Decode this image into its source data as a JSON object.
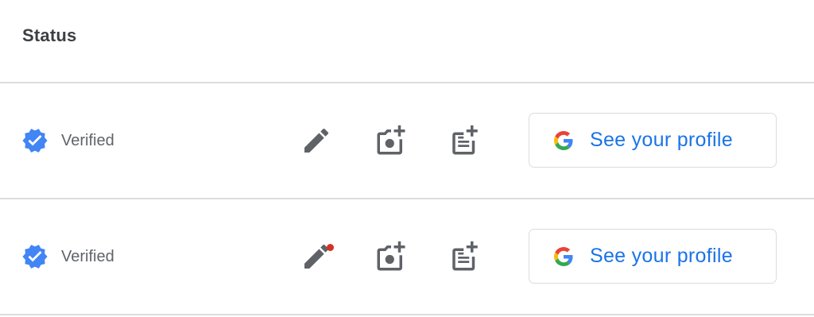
{
  "header": {
    "title": "Status"
  },
  "rows": [
    {
      "status": "Verified",
      "status_icon": "verified-badge-icon",
      "edit_has_notification": false,
      "actions": [
        "edit-pencil-icon",
        "add-photo-icon",
        "add-post-icon"
      ],
      "button_label": "See your profile",
      "button_icon": "google-g-icon"
    },
    {
      "status": "Verified",
      "status_icon": "verified-badge-icon",
      "edit_has_notification": true,
      "actions": [
        "edit-pencil-icon",
        "add-photo-icon",
        "add-post-icon"
      ],
      "button_label": "See your profile",
      "button_icon": "google-g-icon"
    }
  ],
  "colors": {
    "badge_blue": "#4285f4",
    "link_blue": "#1a73e8",
    "icon_gray": "#5f6368",
    "notification_red": "#d93025",
    "divider": "#dadce0"
  }
}
